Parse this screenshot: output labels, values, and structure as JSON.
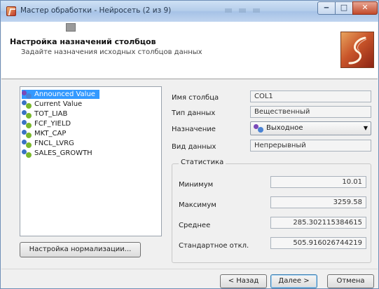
{
  "window": {
    "title": "Мастер обработки - Нейросеть (2 из 9)",
    "minimize_glyph": "‒",
    "maximize_glyph": "□",
    "close_glyph": "✕"
  },
  "header": {
    "title": "Настройка назначений столбцов",
    "subtitle": "Задайте назначения исходных столбцов данных"
  },
  "columns": {
    "items": [
      {
        "label": "Announced Value",
        "icon": "field-icon",
        "selected": true
      },
      {
        "label": "Current Value",
        "icon": "field-icon"
      },
      {
        "label": "TOT_LIAB",
        "icon": "field-icon"
      },
      {
        "label": "FCF_YIELD",
        "icon": "field-icon"
      },
      {
        "label": "MKT_CAP",
        "icon": "field-icon"
      },
      {
        "label": "FNCL_LVRG",
        "icon": "field-icon"
      },
      {
        "label": "SALES_GROWTH",
        "icon": "field-icon"
      }
    ],
    "selected_color": "#3399ff",
    "normalization_button": "Настройка нормализации..."
  },
  "properties": {
    "column_name_label": "Имя столбца",
    "column_name_value": "COL1",
    "data_type_label": "Тип данных",
    "data_type_value": "Вещественный",
    "assignment_label": "Назначение",
    "assignment_value": "Выходное",
    "data_kind_label": "Вид данных",
    "data_kind_value": "Непрерывный"
  },
  "statistics": {
    "legend": "Статистика",
    "rows": [
      {
        "label": "Минимум",
        "value": "10.01"
      },
      {
        "label": "Максимум",
        "value": "3259.58"
      },
      {
        "label": "Среднее",
        "value": "285.302115384615"
      },
      {
        "label": "Стандартное откл.",
        "value": "505.916026744219"
      }
    ]
  },
  "footer": {
    "back": "< Назад",
    "next": "Далее >",
    "cancel": "Отмена"
  }
}
